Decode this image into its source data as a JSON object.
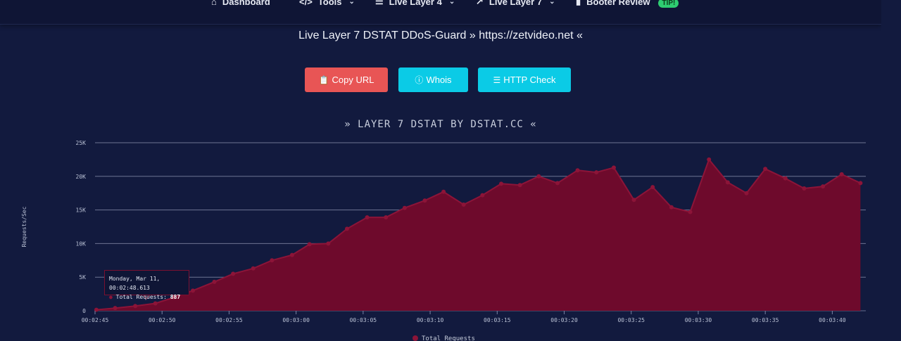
{
  "nav": {
    "items": [
      {
        "label": "Dashboard",
        "icon": "home-icon"
      },
      {
        "label": "Tools",
        "icon": "code-icon"
      },
      {
        "label": "Live Layer 4",
        "icon": "layers-icon"
      },
      {
        "label": "Live Layer 7",
        "icon": "line-chart-icon"
      },
      {
        "label": "Booter Review",
        "icon": "bar-chart-icon",
        "badge": "TIP!"
      }
    ]
  },
  "page": {
    "title": "Live Layer 7 DSTAT DDoS-Guard » https://zetvideo.net «"
  },
  "buttons": {
    "copy_url": "Copy URL",
    "whois": "Whois",
    "http_check": "HTTP Check"
  },
  "colors": {
    "background": "#121a3e",
    "area_fill": "#6e0a2c",
    "line": "#8c1438",
    "copy_button": "#e85555",
    "info_button": "#0bcbe6"
  },
  "tooltip": {
    "date": "Monday, Mar 11, 00:02:48.613",
    "series": "Total Requests",
    "value": "887"
  },
  "chart_data": {
    "type": "area",
    "title": "» LAYER 7 DSTAT BY DSTAT.CC «",
    "ylabel": "Requests/Sec",
    "xlabel": "",
    "ylim": [
      0,
      25000
    ],
    "yticks": [
      "0",
      "5K",
      "10K",
      "15K",
      "20K",
      "25K"
    ],
    "xticks": [
      "00:02:45",
      "00:02:50",
      "00:02:55",
      "00:03:00",
      "00:03:05",
      "00:03:10",
      "00:03:15",
      "00:03:20",
      "00:03:25",
      "00:03:30",
      "00:03:35",
      "00:03:40"
    ],
    "xlim_seconds": [
      165,
      222.5
    ],
    "grid": true,
    "legend_position": "bottom",
    "series": [
      {
        "name": "Total Requests",
        "points": [
          [
            "00:02:45.1",
            150
          ],
          [
            "00:02:46.5",
            400
          ],
          [
            "00:02:48.0",
            700
          ],
          [
            "00:02:49.5",
            1100
          ],
          [
            "00:02:50.9",
            2000
          ],
          [
            "00:02:52.3",
            3000
          ],
          [
            "00:02:53.9",
            4300
          ],
          [
            "00:02:55.3",
            5500
          ],
          [
            "00:02:56.8",
            6300
          ],
          [
            "00:02:58.2",
            7500
          ],
          [
            "00:02:59.7",
            8300
          ],
          [
            "00:03:01.0",
            9900
          ],
          [
            "00:03:02.4",
            10000
          ],
          [
            "00:03:03.8",
            12200
          ],
          [
            "00:03:05.3",
            13900
          ],
          [
            "00:03:06.7",
            13900
          ],
          [
            "00:03:08.1",
            15300
          ],
          [
            "00:03:09.6",
            16400
          ],
          [
            "00:03:11.0",
            17700
          ],
          [
            "00:03:12.5",
            15800
          ],
          [
            "00:03:13.9",
            17200
          ],
          [
            "00:03:15.3",
            18900
          ],
          [
            "00:03:16.7",
            18700
          ],
          [
            "00:03:18.1",
            20000
          ],
          [
            "00:03:19.5",
            19000
          ],
          [
            "00:03:21.0",
            20900
          ],
          [
            "00:03:22.4",
            20600
          ],
          [
            "00:03:23.7",
            21300
          ],
          [
            "00:03:25.2",
            16500
          ],
          [
            "00:03:26.6",
            18400
          ],
          [
            "00:03:28.0",
            15400
          ],
          [
            "00:03:29.4",
            14700
          ],
          [
            "00:03:30.8",
            22500
          ],
          [
            "00:03:32.2",
            19100
          ],
          [
            "00:03:33.6",
            17500
          ],
          [
            "00:03:35.0",
            21100
          ],
          [
            "00:03:36.5",
            19700
          ],
          [
            "00:03:37.9",
            18200
          ],
          [
            "00:03:39.3",
            18500
          ],
          [
            "00:03:40.7",
            20300
          ],
          [
            "00:03:42.1",
            19000
          ]
        ]
      }
    ]
  }
}
